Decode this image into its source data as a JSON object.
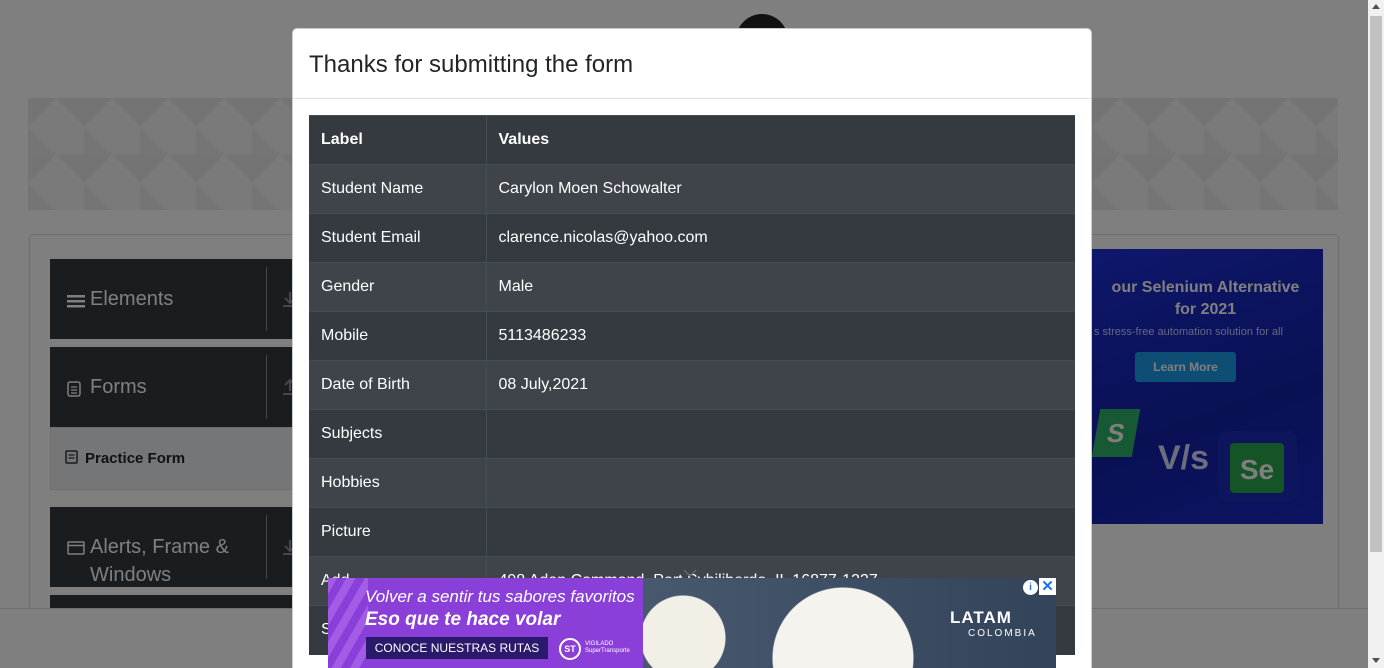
{
  "sidebar": {
    "groups": [
      {
        "label": "Elements",
        "icon": "hamburger-icon"
      },
      {
        "label": "Forms",
        "icon": "document-icon"
      },
      {
        "label": "Alerts, Frame & Windows",
        "label_line1": "Alerts, Frame &",
        "label_line2": "Windows",
        "icon": "window-icon"
      }
    ],
    "active_item": {
      "label": "Practice Form",
      "icon": "form-icon"
    }
  },
  "side_ad": {
    "title_line1": "our Selenium Alternative",
    "title_line2": "for 2021",
    "subtitle": "s stress-free automation solution for all",
    "button": "Learn More",
    "badge_s": "S",
    "vs": "V/s",
    "badge_se": "Se"
  },
  "modal": {
    "title": "Thanks for submitting the form",
    "table": {
      "headers": [
        "Label",
        "Values"
      ],
      "rows": [
        {
          "label": "Student Name",
          "value": "Carylon Moen Schowalter"
        },
        {
          "label": "Student Email",
          "value": "clarence.nicolas@yahoo.com"
        },
        {
          "label": "Gender",
          "value": "Male"
        },
        {
          "label": "Mobile",
          "value": "5113486233"
        },
        {
          "label": "Date of Birth",
          "value": "08 July,2021"
        },
        {
          "label": "Subjects",
          "value": ""
        },
        {
          "label": "Hobbies",
          "value": ""
        },
        {
          "label": "Picture",
          "value": ""
        },
        {
          "label": "Add",
          "value": "498 Adan Commond, Port Sybiliberdo, IL 16877-1227"
        },
        {
          "label": "S",
          "value": ""
        }
      ]
    }
  },
  "bottom_ad": {
    "line1": "Volver a sentir tus sabores favoritos",
    "line2": "Eso que te hace volar",
    "cta": "CONOCE NUESTRAS RUTAS",
    "st_badge": "ST",
    "vigilado": "VIGILADO SuperTransporte",
    "brand": "LATAM",
    "country": "COLOMBIA",
    "info_icon": "i",
    "close_icon": "✕"
  },
  "colors": {
    "table_dark": "#343a40",
    "table_stripe": "#3e444a",
    "sidebar": "#343a40",
    "ad_purple": "#8b3fd9",
    "side_ad_blue": "#1c2fd6"
  }
}
